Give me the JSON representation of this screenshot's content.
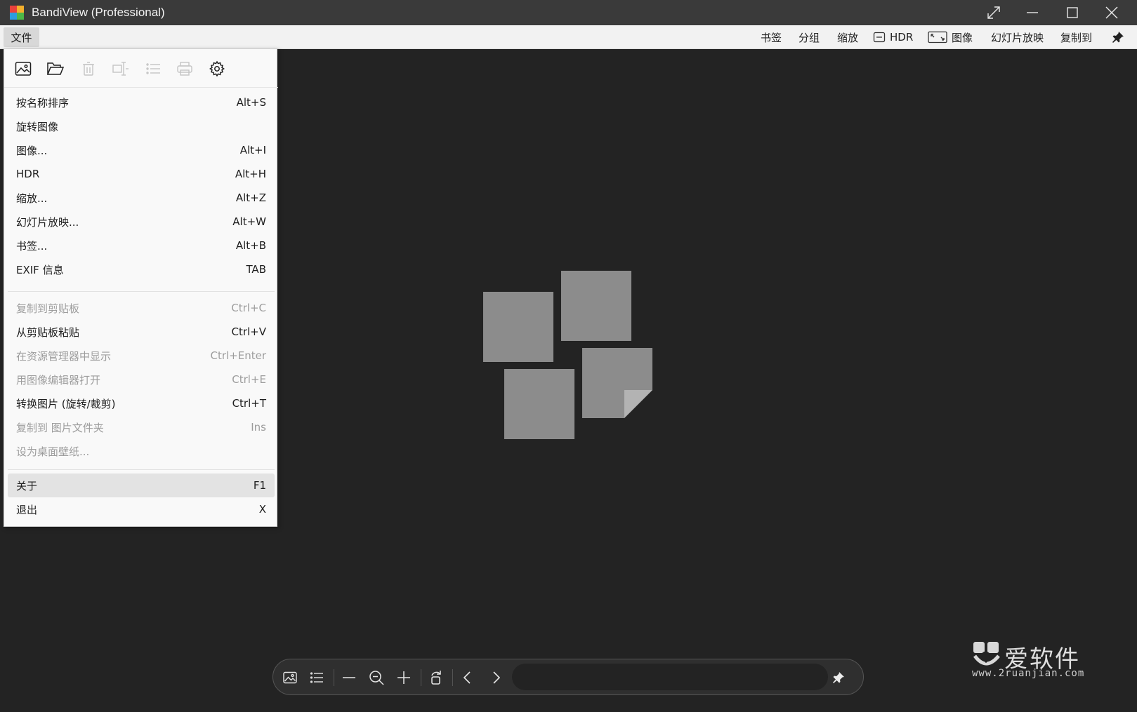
{
  "window": {
    "title": "BandiView (Professional)"
  },
  "menubar": {
    "file": "文件",
    "right_items": [
      {
        "label": "书签"
      },
      {
        "label": "分组"
      },
      {
        "label": "缩放"
      },
      {
        "label": "HDR"
      },
      {
        "label": "图像"
      },
      {
        "label": "幻灯片放映"
      },
      {
        "label": "复制到"
      }
    ]
  },
  "file_menu": {
    "toolbar_icons": [
      "image-icon",
      "folder-open-icon",
      "trash-icon",
      "rename-icon",
      "list-icon",
      "print-icon",
      "gear-icon"
    ],
    "group1": [
      {
        "label": "按名称排序",
        "shortcut": "Alt+S",
        "disabled": false
      },
      {
        "label": "旋转图像",
        "shortcut": "",
        "disabled": false
      },
      {
        "label": "图像...",
        "shortcut": "Alt+I",
        "disabled": false
      },
      {
        "label": "HDR",
        "shortcut": "Alt+H",
        "disabled": false
      },
      {
        "label": "缩放...",
        "shortcut": "Alt+Z",
        "disabled": false
      },
      {
        "label": "幻灯片放映...",
        "shortcut": "Alt+W",
        "disabled": false
      },
      {
        "label": "书签...",
        "shortcut": "Alt+B",
        "disabled": false
      },
      {
        "label": "EXIF 信息",
        "shortcut": "TAB",
        "disabled": false
      }
    ],
    "group2": [
      {
        "label": "复制到剪贴板",
        "shortcut": "Ctrl+C",
        "disabled": true
      },
      {
        "label": "从剪贴板粘贴",
        "shortcut": "Ctrl+V",
        "disabled": false
      },
      {
        "label": "在资源管理器中显示",
        "shortcut": "Ctrl+Enter",
        "disabled": true
      },
      {
        "label": "用图像编辑器打开",
        "shortcut": "Ctrl+E",
        "disabled": true
      },
      {
        "label": "转换图片 (旋转/裁剪)",
        "shortcut": "Ctrl+T",
        "disabled": false
      },
      {
        "label": "复制到 图片文件夹",
        "shortcut": "Ins",
        "disabled": true
      },
      {
        "label": "设为桌面壁纸...",
        "shortcut": "",
        "disabled": true
      }
    ],
    "group3": [
      {
        "label": "关于",
        "shortcut": "F1",
        "disabled": false,
        "highlighted": true
      },
      {
        "label": "退出",
        "shortcut": "X",
        "disabled": false
      }
    ]
  },
  "bottom_toolbar": {
    "icons": [
      "image-icon",
      "list-icon",
      "zoom-out-line-icon",
      "zoom-out-icon",
      "zoom-in-icon",
      "rotate-icon",
      "prev-icon",
      "next-icon",
      "pin-icon"
    ]
  },
  "watermark": {
    "text": "爱软件",
    "url": "www.2ruanjian.com"
  },
  "colors": {
    "titlebar_bg": "#3a3a3a",
    "menubar_bg": "#f2f2f2",
    "viewer_bg": "#232323",
    "placeholder_gray": "#8c8c8c"
  }
}
